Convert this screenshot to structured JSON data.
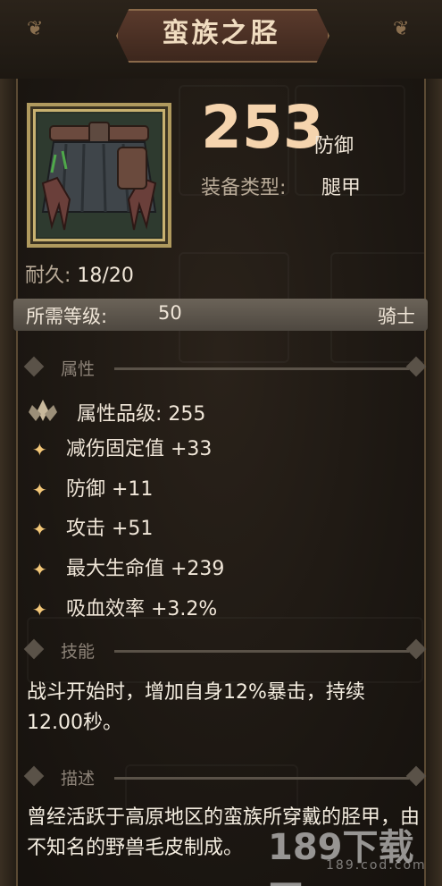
{
  "title": "蛮族之胫",
  "item_icon": "leg-armor-icon",
  "defense": {
    "value": "253",
    "unit": "防御"
  },
  "equip_type": {
    "label": "装备类型:",
    "value": "腿甲"
  },
  "durability": {
    "label": "耐久:",
    "value": "18/20"
  },
  "requirement": {
    "label": "所需等级:",
    "level": "50",
    "class": "骑士"
  },
  "sections": {
    "attributes": "属性",
    "skills": "技能",
    "description": "描述"
  },
  "attribute_grade": "属性品级: 255",
  "stats": [
    "减伤固定值 +33",
    "防御 +11",
    "攻击 +51",
    "最大生命值 +239",
    "吸血效率 +3.2%"
  ],
  "skill_text": "战斗开始时，增加自身12%暴击，持续12.00秒。",
  "description_text": "曾经活跃于高原地区的蛮族所穿戴的胫甲，由不知名的野兽毛皮制成。",
  "watermark": {
    "main": "189下载网",
    "sub": "189.cod.com"
  },
  "colors": {
    "title": "#f0dcc0",
    "number": "#f5d4ae",
    "star": "#f3c778",
    "text": "#f0e6d8"
  }
}
